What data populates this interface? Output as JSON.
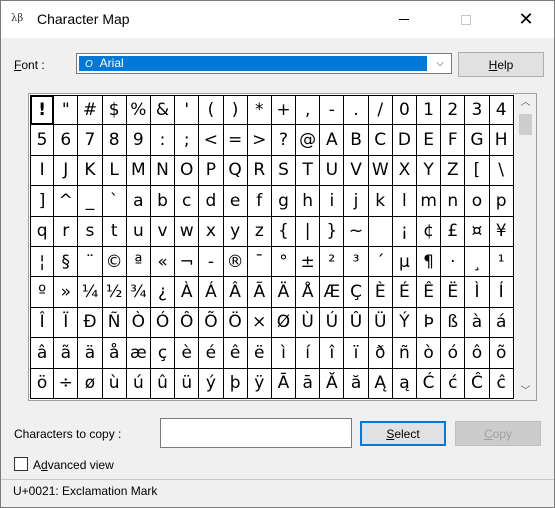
{
  "window": {
    "title": "Character Map",
    "app_icon_glyph": "λβ",
    "minimize_icon": "minimize-icon",
    "maximize_icon": "maximize-icon",
    "close_glyph": "✕"
  },
  "font": {
    "label_prefix": "F",
    "label_rest": "ont :",
    "selected_value": "Arial",
    "font_icon_glyph": "O",
    "dropdown_glyph": "⌵"
  },
  "buttons": {
    "help_prefix": "H",
    "help_rest": "elp",
    "select_prefix": "S",
    "select_rest": "elect",
    "copy_prefix": "C",
    "copy_rest": "opy"
  },
  "grid": {
    "selected_index": 0,
    "rows": [
      [
        "!",
        "\"",
        "#",
        "$",
        "%",
        "&",
        "'",
        "(",
        ")",
        "*",
        "+",
        ",",
        "-",
        ".",
        "/",
        "0",
        "1",
        "2",
        "3",
        "4"
      ],
      [
        "5",
        "6",
        "7",
        "8",
        "9",
        ":",
        ";",
        "<",
        "=",
        ">",
        "?",
        "@",
        "A",
        "B",
        "C",
        "D",
        "E",
        "F",
        "G",
        "H"
      ],
      [
        "I",
        "J",
        "K",
        "L",
        "M",
        "N",
        "O",
        "P",
        "Q",
        "R",
        "S",
        "T",
        "U",
        "V",
        "W",
        "X",
        "Y",
        "Z",
        "[",
        "\\"
      ],
      [
        "]",
        "^",
        "_",
        "`",
        "a",
        "b",
        "c",
        "d",
        "e",
        "f",
        "g",
        "h",
        "i",
        "j",
        "k",
        "l",
        "m",
        "n",
        "o",
        "p"
      ],
      [
        "q",
        "r",
        "s",
        "t",
        "u",
        "v",
        "w",
        "x",
        "y",
        "z",
        "{",
        "|",
        "}",
        "~",
        " ",
        "¡",
        "¢",
        "£",
        "¤",
        "¥"
      ],
      [
        "¦",
        "§",
        "¨",
        "©",
        "ª",
        "«",
        "¬",
        "-",
        "®",
        "¯",
        "°",
        "±",
        "²",
        "³",
        "´",
        "µ",
        "¶",
        "·",
        "¸",
        "¹"
      ],
      [
        "º",
        "»",
        "¼",
        "½",
        "¾",
        "¿",
        "À",
        "Á",
        "Â",
        "Ã",
        "Ä",
        "Å",
        "Æ",
        "Ç",
        "È",
        "É",
        "Ê",
        "Ë",
        "Ì",
        "Í"
      ],
      [
        "Î",
        "Ï",
        "Ð",
        "Ñ",
        "Ò",
        "Ó",
        "Ô",
        "Õ",
        "Ö",
        "×",
        "Ø",
        "Ù",
        "Ú",
        "Û",
        "Ü",
        "Ý",
        "Þ",
        "ß",
        "à",
        "á"
      ],
      [
        "â",
        "ã",
        "ä",
        "å",
        "æ",
        "ç",
        "è",
        "é",
        "ê",
        "ë",
        "ì",
        "í",
        "î",
        "ï",
        "ð",
        "ñ",
        "ò",
        "ó",
        "ô",
        "õ"
      ],
      [
        "ö",
        "÷",
        "ø",
        "ù",
        "ú",
        "û",
        "ü",
        "ý",
        "þ",
        "ÿ",
        "Ā",
        "ā",
        "Ă",
        "ă",
        "Ą",
        "ą",
        "Ć",
        "ć",
        "Ĉ",
        "ĉ"
      ]
    ],
    "scroll_up_glyph": "︿",
    "scroll_down_glyph": "﹀"
  },
  "copy": {
    "label_prefix": "Characters to copy",
    "label_suffix": " :",
    "value": ""
  },
  "advanced": {
    "label_prefix": "A",
    "label_u": "d",
    "label_rest": "vanced view",
    "checked": false
  },
  "status": {
    "text": "U+0021: Exclamation Mark"
  },
  "colors": {
    "selection": "#0078d7",
    "background": "#f0f0f0"
  }
}
